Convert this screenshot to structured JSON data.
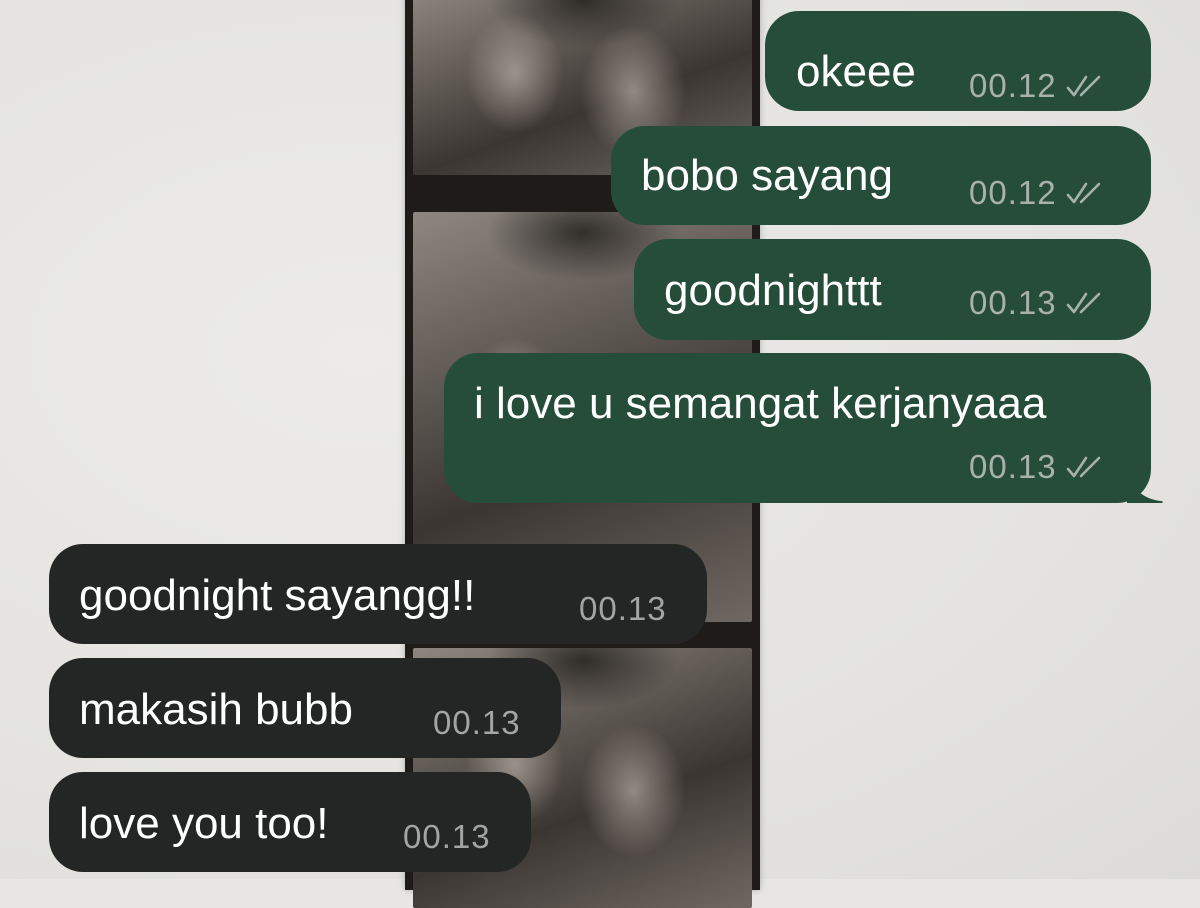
{
  "messages": [
    {
      "direction": "outgoing",
      "text": "okeee",
      "time": "00.12",
      "status_icon": "double-check-icon"
    },
    {
      "direction": "outgoing",
      "text": "bobo sayang",
      "time": "00.12",
      "status_icon": "double-check-icon"
    },
    {
      "direction": "outgoing",
      "text": "goodnighttt",
      "time": "00.13",
      "status_icon": "double-check-icon"
    },
    {
      "direction": "outgoing",
      "text": "i love u semangat kerjanyaaa",
      "time": "00.13",
      "status_icon": "double-check-icon"
    },
    {
      "direction": "incoming",
      "text": "goodnight sayangg!!",
      "time": "00.13"
    },
    {
      "direction": "incoming",
      "text": "makasih bubb",
      "time": "00.13"
    },
    {
      "direction": "incoming",
      "text": "love you too!",
      "time": "00.13"
    }
  ],
  "colors": {
    "outgoing_bubble": "#264d39",
    "incoming_bubble": "#242626",
    "wallpaper": "#e7e6e3",
    "timestamp": "#a9b1ad"
  },
  "wallpaper": {
    "icon": "photo-strip-wallpaper"
  }
}
